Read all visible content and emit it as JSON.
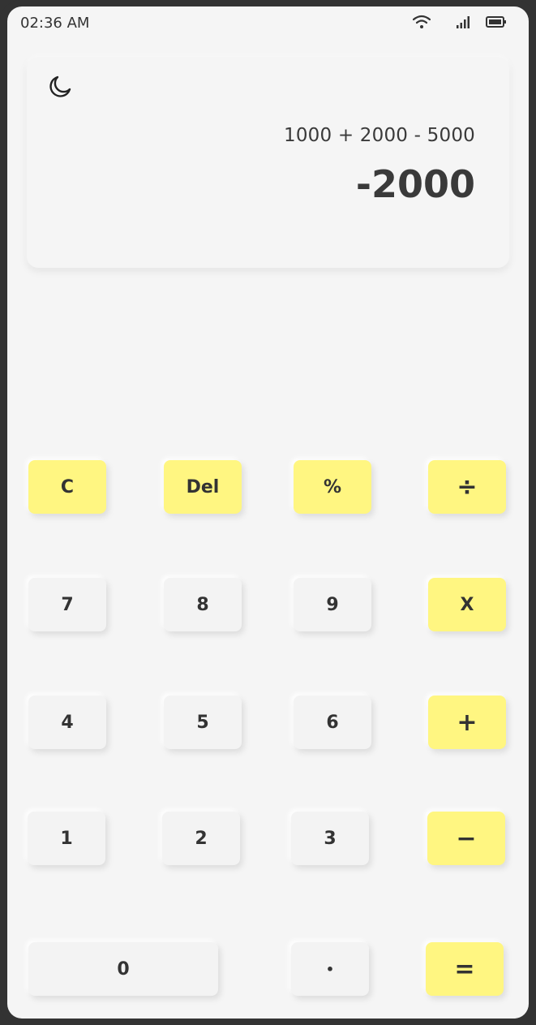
{
  "status_bar": {
    "time": "02:36 AM",
    "icons": [
      "wifi-icon",
      "signal-icon",
      "battery-icon"
    ]
  },
  "display": {
    "theme_icon": "moon-icon",
    "expression": "1000 + 2000 - 5000",
    "result": "-2000"
  },
  "keypad": {
    "clear": "C",
    "delete": "Del",
    "percent": "%",
    "divide": "÷",
    "seven": "7",
    "eight": "8",
    "nine": "9",
    "multiply": "X",
    "four": "4",
    "five": "5",
    "six": "6",
    "plus": "+",
    "one": "1",
    "two": "2",
    "three": "3",
    "minus": "−",
    "zero": "0",
    "decimal": "•",
    "equals": "="
  },
  "colors": {
    "operator_key": "#fff681",
    "number_key": "#f3f3f3",
    "background": "#f5f5f5",
    "text": "#333333"
  }
}
